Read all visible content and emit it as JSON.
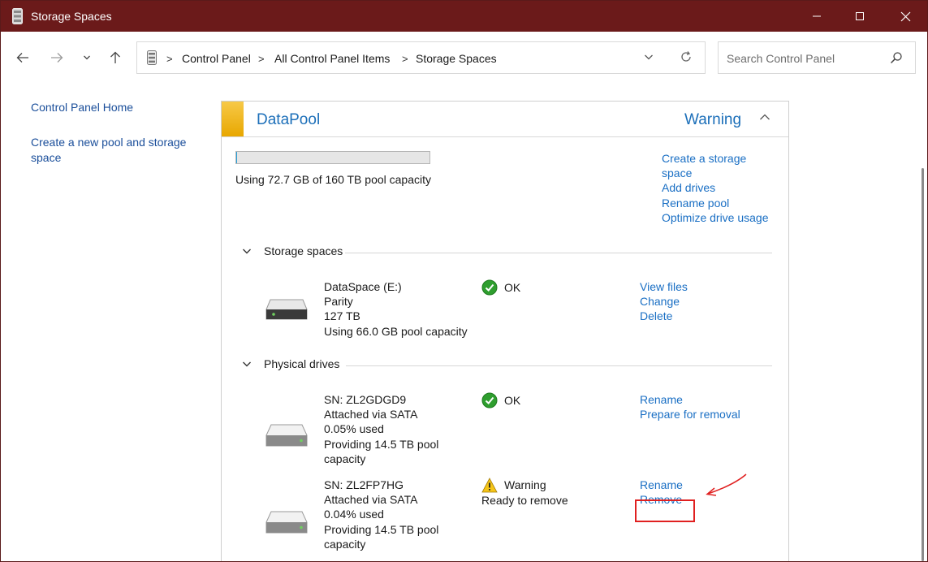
{
  "window": {
    "title": "Storage Spaces"
  },
  "address": {
    "crumbs": [
      "Control Panel",
      "All Control Panel Items",
      "Storage Spaces"
    ]
  },
  "search": {
    "placeholder": "Search Control Panel"
  },
  "sidebar": {
    "home": "Control Panel Home",
    "create": "Create a new pool and storage space"
  },
  "pool": {
    "name": "DataPool",
    "status": "Warning",
    "usage_text": "Using 72.7 GB of 160 TB pool capacity",
    "usage_fraction": 0.0005,
    "links": [
      "Create a storage space",
      "Add drives",
      "Rename pool",
      "Optimize drive usage"
    ]
  },
  "storage_spaces": {
    "label": "Storage spaces",
    "items": [
      {
        "lines": [
          "DataSpace (E:)",
          "Parity",
          "127 TB",
          "Using 66.0 GB pool capacity"
        ],
        "status": "OK",
        "links": [
          "View files",
          "Change",
          "Delete"
        ]
      }
    ]
  },
  "physical_drives": {
    "label": "Physical drives",
    "items": [
      {
        "lines": [
          "SN: ZL2GDGD9",
          "Attached via SATA",
          "0.05% used",
          "Providing 14.5 TB pool capacity"
        ],
        "status": "OK",
        "links": [
          "Rename",
          "Prepare for removal"
        ]
      },
      {
        "lines": [
          "SN: ZL2FP7HG",
          "Attached via SATA",
          "0.04% used",
          "Providing 14.5 TB pool capacity"
        ],
        "status": "Warning",
        "status_detail": "Ready to remove",
        "links": [
          "Rename",
          "Remove"
        ]
      }
    ]
  },
  "colors": {
    "titlebar": "#6b1a1a",
    "accent": "#e8a700",
    "link": "#1a6fc4",
    "highlight": "#e02020"
  }
}
